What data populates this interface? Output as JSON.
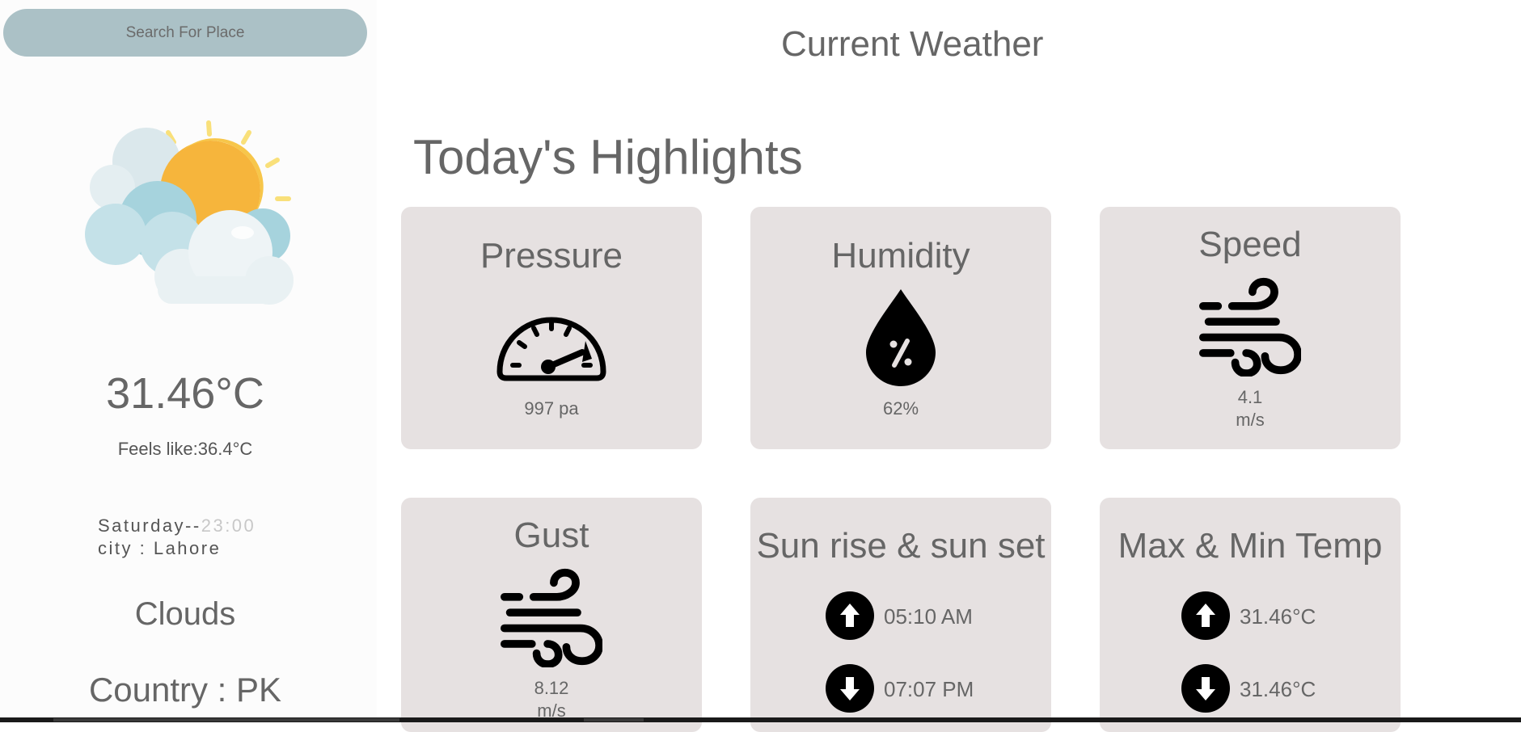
{
  "search": {
    "placeholder": "Search For Place"
  },
  "current": {
    "icon": "sun-behind-clouds-icon",
    "temperature": "31.46°C",
    "feels_like": "Feels like:36.4°C",
    "day": "Saturday--",
    "time": "23:00",
    "city": "city : Lahore",
    "condition": "Clouds",
    "country": "Country : PK"
  },
  "header": {
    "title": "Current Weather"
  },
  "highlights": {
    "title": "Today's Highlights",
    "pressure": {
      "label": "Pressure",
      "value": "997 pa",
      "icon": "gauge-icon"
    },
    "humidity": {
      "label": "Humidity",
      "value": "62%",
      "icon": "water-drop-percent-icon"
    },
    "speed": {
      "label": "Speed",
      "value": "4.1",
      "unit": "m/s",
      "icon": "wind-icon"
    },
    "gust": {
      "label": "Gust",
      "value": "8.12",
      "unit": "m/s",
      "icon": "wind-icon"
    },
    "sun": {
      "label": "Sun rise & sun set",
      "sunrise": "05:10 AM",
      "sunset": "07:07 PM"
    },
    "temp_range": {
      "label": "Max & Min Temp",
      "max": "31.46°C",
      "min": "31.46°C"
    }
  },
  "colors": {
    "search_bg": "#abc1c6",
    "card_bg": "#e6e1e1",
    "text": "#666666",
    "sidebar_bg": "#fcfcfc"
  }
}
